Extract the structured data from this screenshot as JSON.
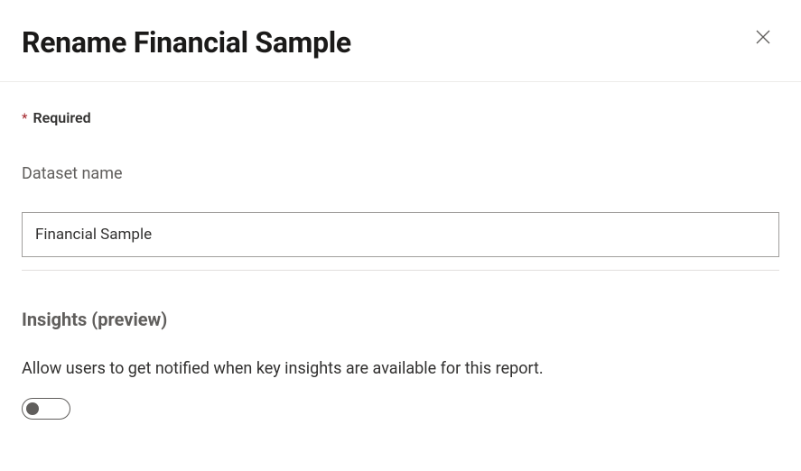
{
  "dialog": {
    "title": "Rename Financial Sample",
    "required_label": "Required",
    "required_asterisk": "*"
  },
  "dataset_name": {
    "label": "Dataset name",
    "value": "Financial Sample"
  },
  "insights": {
    "heading": "Insights (preview)",
    "description": "Allow users to get notified when key insights are available for this report.",
    "toggle_state": "off"
  }
}
